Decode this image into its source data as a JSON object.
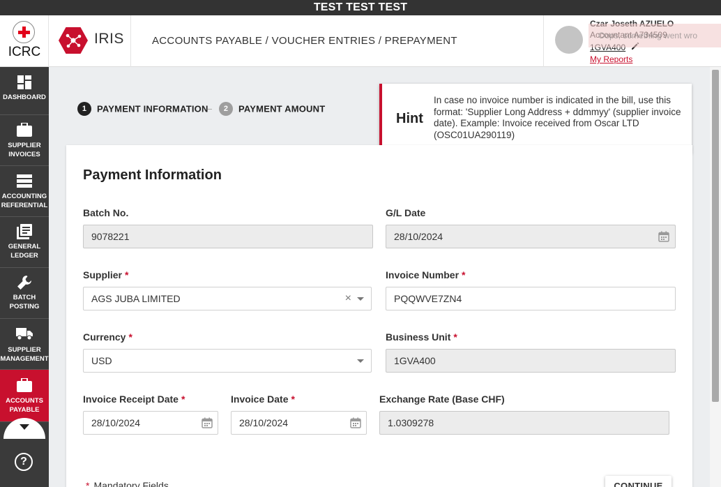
{
  "banner": "TEST TEST TEST",
  "brand": {
    "org": "ICRC",
    "app": "IRIS"
  },
  "breadcrumb": "ACCOUNTS PAYABLE / VOUCHER ENTRIES / PREPAYMENT",
  "user": {
    "name": "Czar Joseth AZUELO",
    "role": "Accountant A734509",
    "business_unit": "1GVA400",
    "reports_link": "My Reports"
  },
  "toast": "Oops, something went wro",
  "sidebar": {
    "items": [
      {
        "label": "DASHBOARD",
        "icon": "dashboard-icon"
      },
      {
        "label": "SUPPLIER INVOICES",
        "icon": "briefcase-icon"
      },
      {
        "label": "ACCOUNTING REFERENTIAL",
        "icon": "list-icon"
      },
      {
        "label": "GENERAL LEDGER",
        "icon": "ledger-icon"
      },
      {
        "label": "BATCH POSTING",
        "icon": "wrench-icon"
      },
      {
        "label": "SUPPLIER MANAGEMENT",
        "icon": "truck-icon"
      },
      {
        "label": "ACCOUNTS PAYABLE",
        "icon": "briefcase-icon",
        "active": true
      }
    ],
    "help": "?"
  },
  "stepper": {
    "steps": [
      {
        "number": "1",
        "label": "PAYMENT INFORMATION",
        "active": true
      },
      {
        "number": "2",
        "label": "PAYMENT AMOUNT",
        "active": false
      }
    ]
  },
  "hint": {
    "title": "Hint",
    "text": "In case no invoice number is indicated in the bill, use this format: 'Supplier Long Address + ddmmyy' (supplier invoice date). Example: Invoice received from Oscar LTD (OSC01UA290119)"
  },
  "form": {
    "title": "Payment Information",
    "batch_no": {
      "label": "Batch No.",
      "value": "9078221"
    },
    "gl_date": {
      "label": "G/L Date",
      "value": "28/10/2024"
    },
    "supplier": {
      "label": "Supplier",
      "value": "AGS JUBA LIMITED",
      "clear": "×"
    },
    "invoice_number": {
      "label": "Invoice Number",
      "value": "PQQWVE7ZN4"
    },
    "currency": {
      "label": "Currency",
      "value": "USD"
    },
    "business_unit": {
      "label": "Business Unit",
      "value": "1GVA400"
    },
    "invoice_receipt_date": {
      "label": "Invoice Receipt Date",
      "value": "28/10/2024"
    },
    "invoice_date": {
      "label": "Invoice Date",
      "value": "28/10/2024"
    },
    "exchange_rate": {
      "label": "Exchange Rate (Base CHF)",
      "value": "1.0309278"
    },
    "required_mark": "*",
    "mandatory_note": "Mandatory Fields",
    "continue_label": "CONTINUE"
  },
  "colors": {
    "brand_red": "#c8102e",
    "sidebar_bg": "#3a3a3a",
    "active_step": "#222222",
    "inactive_step": "#9e9e9e"
  }
}
